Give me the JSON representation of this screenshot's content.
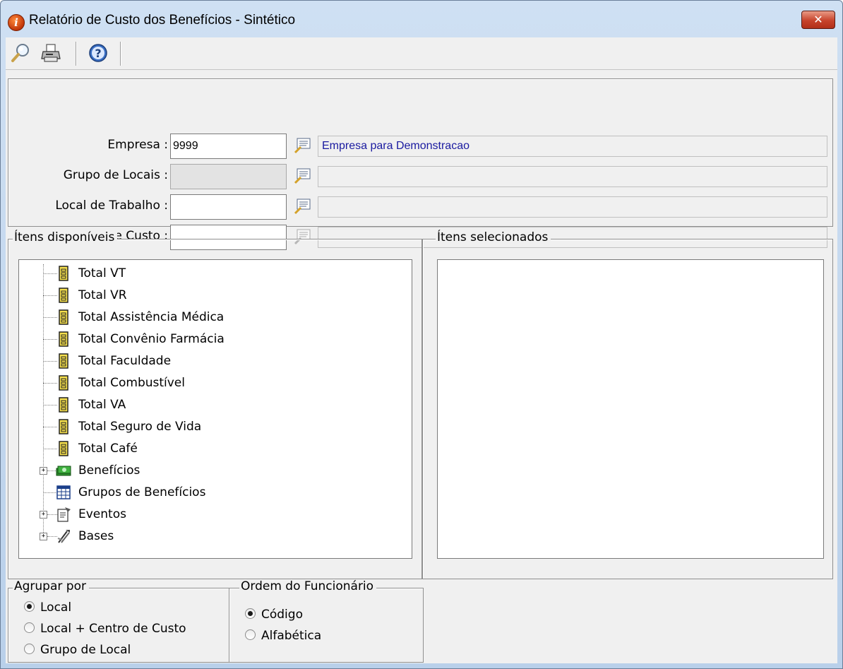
{
  "window": {
    "title": "Relatório de Custo dos Benefícios - Sintético",
    "close_glyph": "✕"
  },
  "toolbar": {
    "buttons": [
      "search-icon",
      "printer-icon",
      "help-icon"
    ]
  },
  "filters": {
    "empresa": {
      "label": "Empresa :",
      "value": "9999",
      "description": "Empresa para Demonstracao"
    },
    "grupo_locais": {
      "label": "Grupo de Locais :",
      "value": "",
      "description": ""
    },
    "local_trabalho": {
      "label": "Local de Trabalho :",
      "value": "",
      "description": ""
    },
    "centro_custo": {
      "label": "Centro de Custo :",
      "value": "",
      "description": ""
    }
  },
  "available": {
    "title": "Ítens disponíveis",
    "items": [
      {
        "label": "Total VT",
        "icon": "total-icon",
        "expandable": false
      },
      {
        "label": "Total VR",
        "icon": "total-icon",
        "expandable": false
      },
      {
        "label": "Total Assistência Médica",
        "icon": "total-icon",
        "expandable": false
      },
      {
        "label": "Total Convênio Farmácia",
        "icon": "total-icon",
        "expandable": false
      },
      {
        "label": "Total Faculdade",
        "icon": "total-icon",
        "expandable": false
      },
      {
        "label": "Total Combustível",
        "icon": "total-icon",
        "expandable": false
      },
      {
        "label": "Total VA",
        "icon": "total-icon",
        "expandable": false
      },
      {
        "label": "Total Seguro de Vida",
        "icon": "total-icon",
        "expandable": false
      },
      {
        "label": "Total Café",
        "icon": "total-icon",
        "expandable": false
      },
      {
        "label": "Benefícios",
        "icon": "money-icon",
        "expandable": true
      },
      {
        "label": "Grupos de Benefícios",
        "icon": "table-icon",
        "expandable": false
      },
      {
        "label": "Eventos",
        "icon": "document-icon",
        "expandable": true
      },
      {
        "label": "Bases",
        "icon": "tools-icon",
        "expandable": true
      }
    ]
  },
  "selected": {
    "title": "Ítens selecionados",
    "items": []
  },
  "group_by": {
    "title": "Agrupar por",
    "options": [
      {
        "label": "Local",
        "checked": true
      },
      {
        "label": "Local + Centro de Custo",
        "checked": false
      },
      {
        "label": "Grupo de Local",
        "checked": false
      }
    ]
  },
  "employee_order": {
    "title": "Ordem do Funcionário",
    "options": [
      {
        "label": "Código",
        "checked": true
      },
      {
        "label": "Alfabética",
        "checked": false
      }
    ]
  }
}
